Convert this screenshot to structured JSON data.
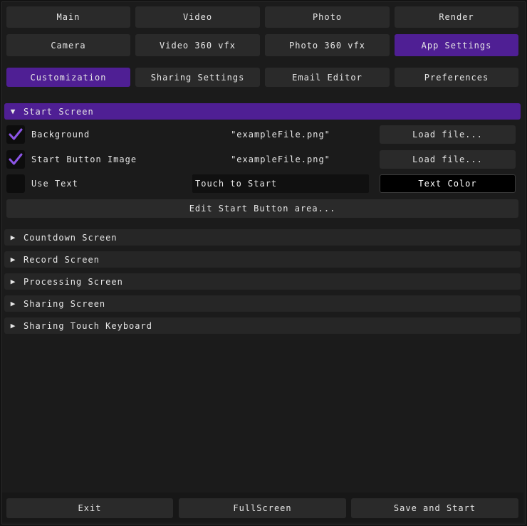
{
  "colors": {
    "accent": "#4f1f94",
    "check": "#8c55e6"
  },
  "main_tabs": {
    "main": "Main",
    "video": "Video",
    "photo": "Photo",
    "render": "Render",
    "camera": "Camera",
    "video360": "Video 360 vfx",
    "photo360": "Photo 360 vfx",
    "app_settings": "App Settings"
  },
  "sub_tabs": {
    "customization": "Customization",
    "sharing_settings": "Sharing Settings",
    "email_editor": "Email Editor",
    "preferences": "Preferences"
  },
  "start_screen": {
    "title": "Start Screen",
    "background": {
      "label": "Background",
      "checked": true,
      "file": "\"exampleFile.png\"",
      "button": "Load file..."
    },
    "start_button_image": {
      "label": "Start Button Image",
      "checked": true,
      "file": "\"exampleFile.png\"",
      "button": "Load file..."
    },
    "use_text": {
      "label": "Use Text",
      "checked": false,
      "value": "Touch to Start",
      "color_button": "Text Color"
    },
    "edit_area_button": "Edit Start Button area..."
  },
  "sections": {
    "countdown": "Countdown Screen",
    "record": "Record Screen",
    "processing": "Processing Screen",
    "sharing": "Sharing Screen",
    "sharing_keyboard": "Sharing Touch Keyboard"
  },
  "footer": {
    "exit": "Exit",
    "fullscreen": "FullScreen",
    "save_start": "Save and Start"
  }
}
